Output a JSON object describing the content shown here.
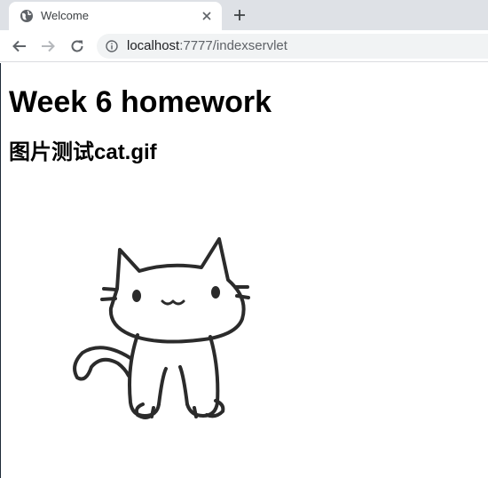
{
  "browser": {
    "tab": {
      "title": "Welcome",
      "favicon": "globe-icon"
    },
    "address": {
      "host": "localhost",
      "path": ":7777/indexservlet"
    },
    "icons": [
      "globe-icon",
      "close-icon",
      "plus-icon",
      "back-arrow-icon",
      "forward-arrow-icon",
      "reload-icon",
      "info-icon"
    ]
  },
  "page": {
    "heading": "Week 6 homework",
    "subheading": "图片测试cat.gif",
    "image_alt": "cat.gif"
  },
  "colors": {
    "tab_strip": "#dee1e6",
    "omnibox": "#f1f3f4",
    "ink": "#2b2b2b"
  }
}
